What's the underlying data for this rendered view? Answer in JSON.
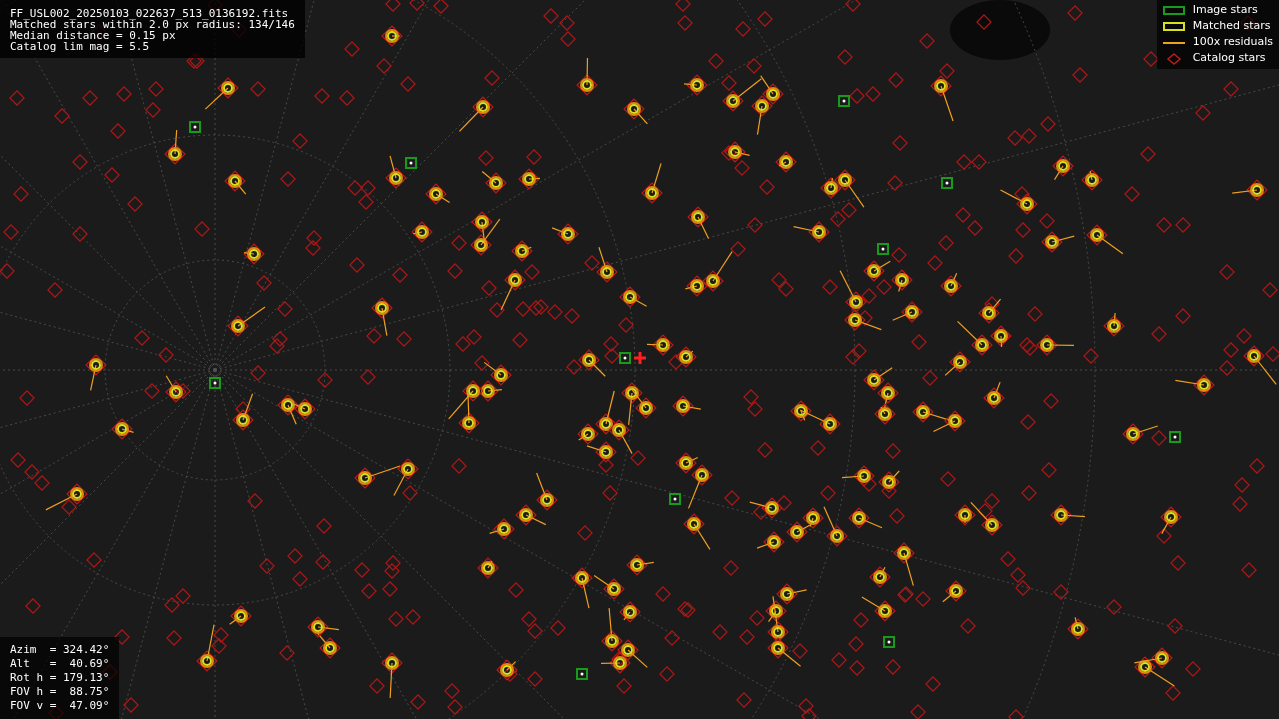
{
  "info_lines": [
    "FF_USL002_20250103_022637_513_0136192.fits",
    "Matched stars within 2.0 px radius: 134/146",
    "Median distance = 0.15 px",
    "Catalog lim mag = 5.5"
  ],
  "legend": [
    {
      "kind": "image",
      "label": "Image stars"
    },
    {
      "kind": "matched",
      "label": "Matched stars"
    },
    {
      "kind": "residual",
      "label": "100x residuals"
    },
    {
      "kind": "catalog",
      "label": "Catalog stars"
    }
  ],
  "pointing_lines": [
    "Azim  = 324.42°",
    "Alt   =  40.69°",
    "Rot h = 179.13°",
    "FOV h =  88.75°",
    "FOV v =  47.09°"
  ]
}
